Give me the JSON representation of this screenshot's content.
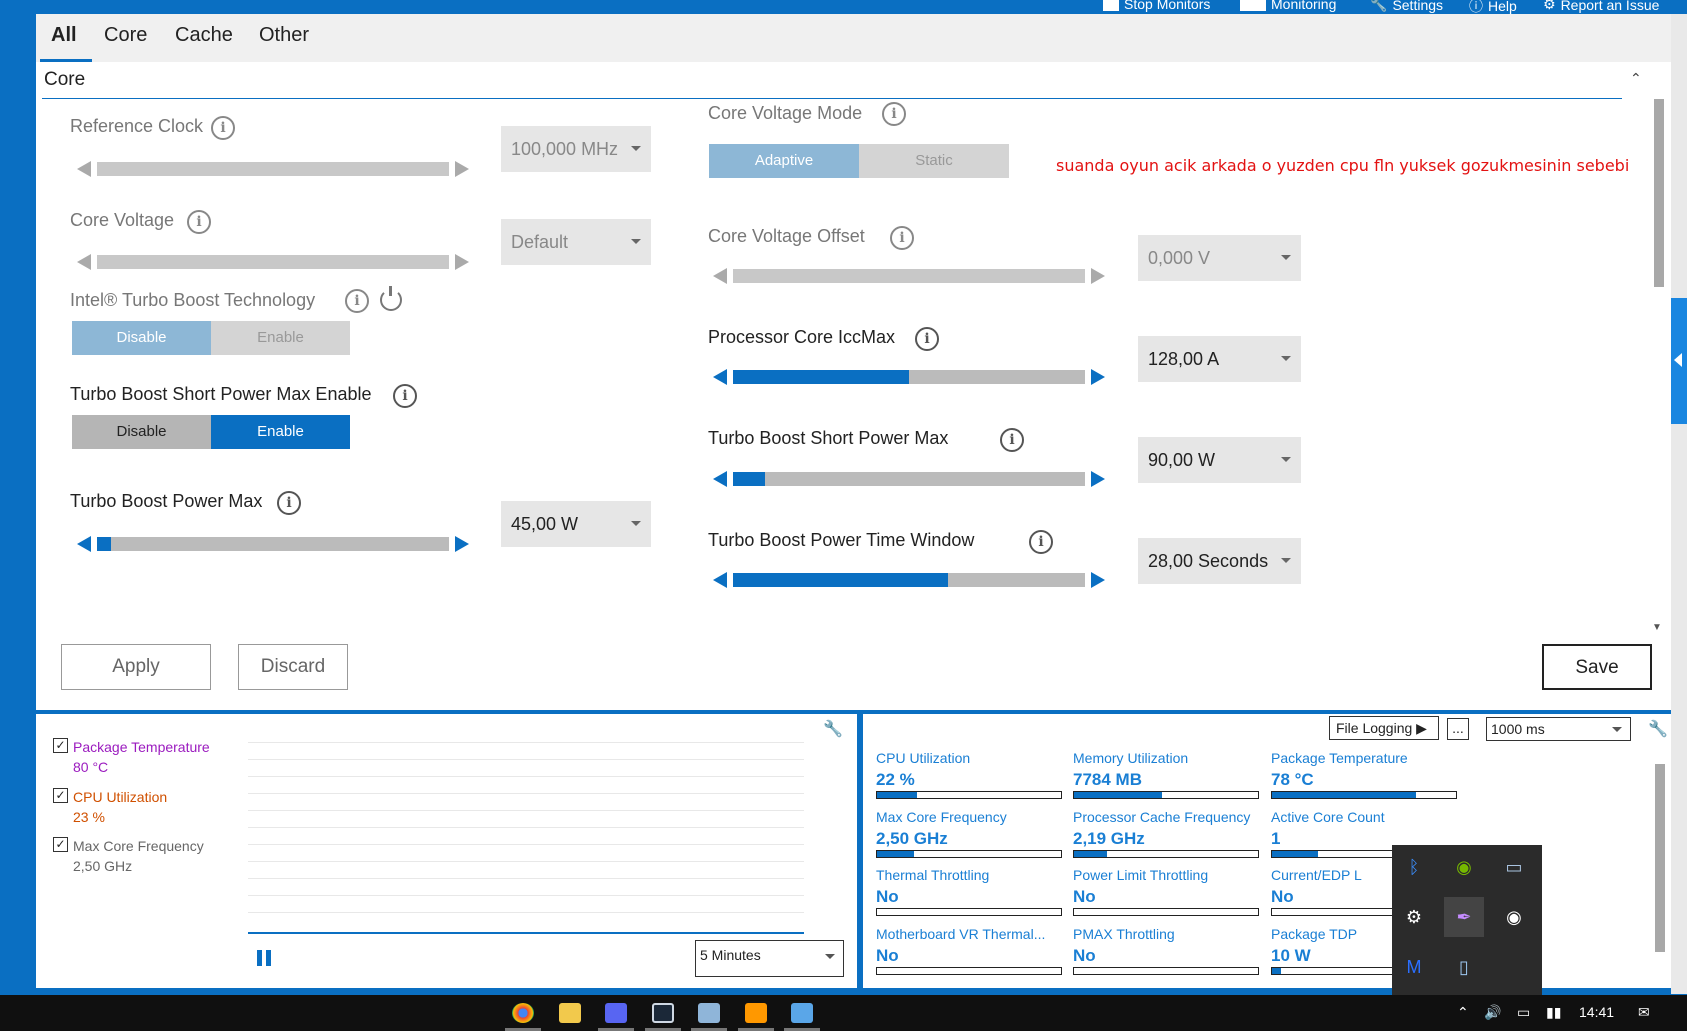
{
  "toolbar": {
    "stop_monitors": "Stop Monitors",
    "monitoring": "Monitoring",
    "settings": "Settings",
    "help": "Help",
    "report": "Report an Issue"
  },
  "tabs": [
    "All",
    "Core",
    "Cache",
    "Other"
  ],
  "section_title": "Core",
  "left": {
    "reference_clock": {
      "label": "Reference Clock",
      "value": "100,000 MHz",
      "level": 0.0
    },
    "core_voltage": {
      "label": "Core Voltage",
      "value": "Default",
      "level": 0.0
    },
    "turbo_boost_tech": {
      "label": "Intel® Turbo Boost Technology",
      "opt1": "Disable",
      "opt2": "Enable",
      "selected": "Disable"
    },
    "short_power_max_enable": {
      "label": "Turbo Boost Short Power Max Enable",
      "opt1": "Disable",
      "opt2": "Enable",
      "selected": "Enable"
    },
    "power_max": {
      "label": "Turbo Boost Power Max",
      "value": "45,00 W",
      "level": 0.04
    }
  },
  "right": {
    "voltage_mode": {
      "label": "Core Voltage Mode",
      "opt1": "Adaptive",
      "opt2": "Static",
      "selected": "Adaptive"
    },
    "voltage_offset": {
      "label": "Core Voltage Offset",
      "value": "0,000 V",
      "level": 0.0
    },
    "iccmax": {
      "label": "Processor Core IccMax",
      "value": "128,00 A",
      "level": 0.5
    },
    "short_power_max": {
      "label": "Turbo Boost Short Power Max",
      "value": "90,00 W",
      "level": 0.09
    },
    "time_window": {
      "label": "Turbo Boost Power Time Window",
      "value": "28,00 Seconds",
      "level": 0.61
    }
  },
  "note": "suanda oyun acik arkada o yuzden cpu fln yuksek gozukmesinin sebebi",
  "buttons": {
    "apply": "Apply",
    "discard": "Discard",
    "save": "Save"
  },
  "graph": {
    "legend": [
      {
        "name": "Package Temperature",
        "value": "80 °C",
        "color": "#9b1bbf"
      },
      {
        "name": "CPU Utilization",
        "value": "23 %",
        "color": "#d05000"
      },
      {
        "name": "Max Core Frequency",
        "value": "2,50 GHz",
        "color": "#666666"
      }
    ],
    "duration": "5 Minutes"
  },
  "stats_toolbar": {
    "file_logging": "File Logging",
    "more": "...",
    "interval": "1000 ms"
  },
  "stats": [
    {
      "title": "CPU Utilization",
      "value": "22 %",
      "level": 0.22
    },
    {
      "title": "Memory Utilization",
      "value": "7784  MB",
      "level": 0.48
    },
    {
      "title": "Package Temperature",
      "value": "78 °C",
      "level": 0.78
    },
    {
      "title": "Max Core Frequency",
      "value": "2,50 GHz",
      "level": 0.2
    },
    {
      "title": "Processor Cache Frequency",
      "value": "2,19 GHz",
      "level": 0.18
    },
    {
      "title": "Active Core Count",
      "value": "1",
      "level": 0.25
    },
    {
      "title": "Thermal Throttling",
      "value": "No",
      "level": 0.0
    },
    {
      "title": "Power Limit Throttling",
      "value": "No",
      "level": 0.0
    },
    {
      "title": "Current/EDP L",
      "value": "No",
      "level": 0.0
    },
    {
      "title": "Motherboard VR Thermal...",
      "value": "No",
      "level": 0.0
    },
    {
      "title": "PMAX Throttling",
      "value": "No",
      "level": 0.0
    },
    {
      "title": "Package TDP",
      "value": "10 W",
      "level": 0.05
    }
  ],
  "taskbar": {
    "clock": "14:41"
  },
  "icons": {
    "taskbar": [
      "chrome-icon",
      "file-explorer-icon",
      "discord-icon",
      "steam-icon",
      "photos-icon",
      "sublime-icon",
      "notepad-icon"
    ],
    "tray": [
      "bluetooth-icon",
      "nvidia-icon",
      "display-icon",
      "steam-icon",
      "feather-icon",
      "discord-icon",
      "malwarebytes-icon",
      "device-icon"
    ]
  }
}
